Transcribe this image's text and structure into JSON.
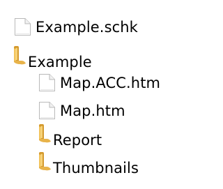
{
  "tree": {
    "items": [
      {
        "label": "Example.schk",
        "icon": "document-icon",
        "type": "file",
        "level": 0
      },
      {
        "label": "Example",
        "icon": "folder-icon",
        "type": "folder",
        "level": 0
      },
      {
        "label": "Map.ACC.htm",
        "icon": "document-icon",
        "type": "file",
        "level": 1
      },
      {
        "label": "Map.htm",
        "icon": "document-icon",
        "type": "file",
        "level": 1
      },
      {
        "label": "Report",
        "icon": "folder-icon",
        "type": "folder",
        "level": 1
      },
      {
        "label": "Thumbnails",
        "icon": "folder-icon",
        "type": "folder",
        "level": 1
      }
    ]
  },
  "colors": {
    "background": "#ffffff",
    "text": "#000000",
    "folder_main": "#e8b34a",
    "folder_dark": "#c98c24",
    "document_border": "#b9b9b9"
  }
}
